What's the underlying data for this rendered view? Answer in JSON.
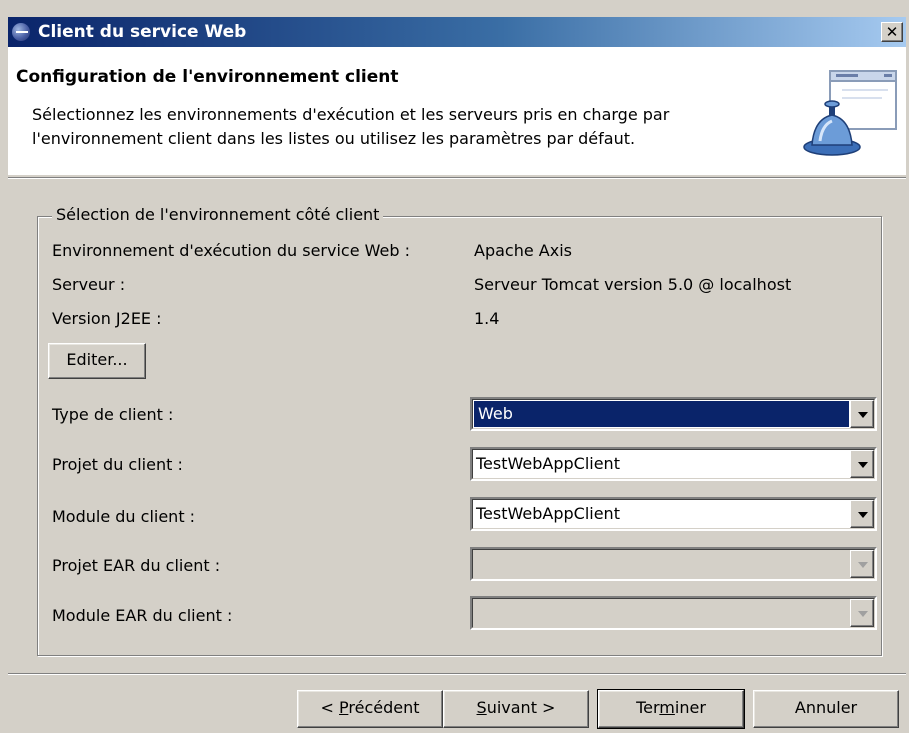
{
  "window": {
    "title": "Client du service Web",
    "close_label": "✕"
  },
  "header": {
    "title": "Configuration de l'environnement client",
    "description_line1": "Sélectionnez les environnements d'exécution et les serveurs pris en charge par",
    "description_line2": "l'environnement client dans les listes ou utilisez les paramètres par défaut.",
    "banner_icon": "service-bell-window-icon"
  },
  "group": {
    "legend": "Sélection de l'environnement côté client",
    "runtime_label": "Environnement d'exécution du service Web :",
    "runtime_value": "Apache Axis",
    "server_label": "Serveur :",
    "server_value": "Serveur Tomcat version 5.0 @ localhost",
    "j2ee_label": "Version J2EE :",
    "j2ee_value": "1.4",
    "edit_button": "Editer..."
  },
  "form": {
    "client_type": {
      "label": "Type de client :",
      "value": "Web",
      "selected": true
    },
    "client_project": {
      "label": "Projet du client :",
      "value": "TestWebAppClient"
    },
    "client_module": {
      "label": "Module du client :",
      "value": "TestWebAppClient"
    },
    "ear_project": {
      "label": "Projet EAR du client :",
      "value": "",
      "disabled": true
    },
    "ear_module": {
      "label": "Module EAR du client :",
      "value": "",
      "disabled": true
    }
  },
  "buttons": {
    "back_prefix": "< ",
    "back_mnemonic": "P",
    "back_rest": "récédent",
    "next_mnemonic": "S",
    "next_rest": "uivant >",
    "finish_prefix": "Ter",
    "finish_mnemonic": "m",
    "finish_rest": "iner",
    "cancel": "Annuler"
  },
  "colors": {
    "titlebar_start": "#0a246a",
    "titlebar_end": "#a6caf0",
    "selection": "#0a246a",
    "dialog_bg": "#d4d0c8"
  }
}
